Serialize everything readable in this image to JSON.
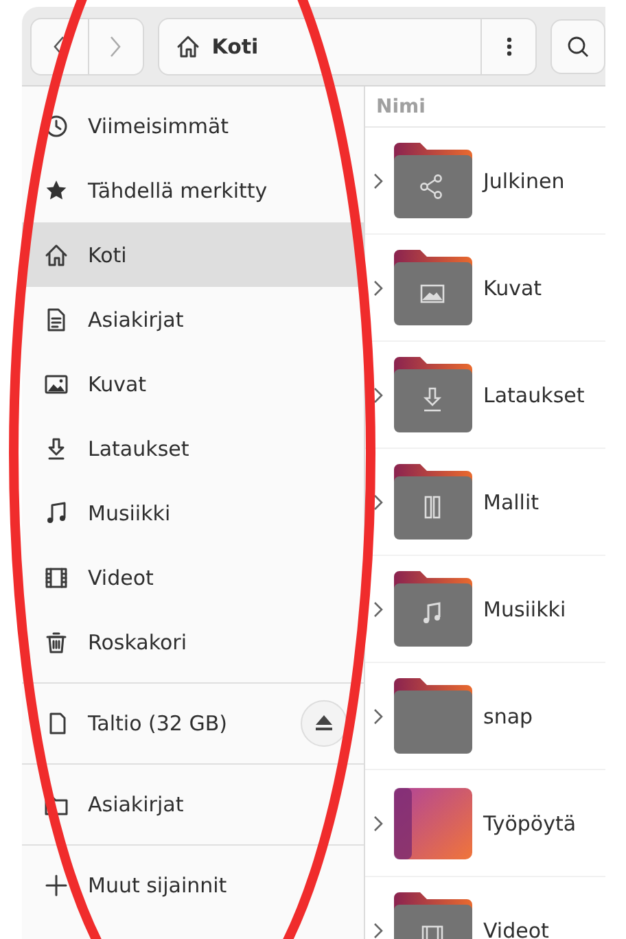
{
  "header": {
    "path": "Koti"
  },
  "sidebar": {
    "places": [
      {
        "label": "Viimeisimmät",
        "selected": false
      },
      {
        "label": "Tähdellä merkitty",
        "selected": false
      },
      {
        "label": "Koti",
        "selected": true
      },
      {
        "label": "Asiakirjat",
        "selected": false
      },
      {
        "label": "Kuvat",
        "selected": false
      },
      {
        "label": "Lataukset",
        "selected": false
      },
      {
        "label": "Musiikki",
        "selected": false
      },
      {
        "label": "Videot",
        "selected": false
      },
      {
        "label": "Roskakori",
        "selected": false
      }
    ],
    "devices": [
      {
        "label": "Taltio (32 GB)"
      }
    ],
    "bookmarks": [
      {
        "label": "Asiakirjat"
      }
    ],
    "other": {
      "label": "Muut sijainnit"
    }
  },
  "files": {
    "column": "Nimi",
    "rows": [
      {
        "name": "Julkinen"
      },
      {
        "name": "Kuvat"
      },
      {
        "name": "Lataukset"
      },
      {
        "name": "Mallit"
      },
      {
        "name": "Musiikki"
      },
      {
        "name": "snap"
      },
      {
        "name": "Työpöytä"
      },
      {
        "name": "Videot"
      }
    ]
  }
}
